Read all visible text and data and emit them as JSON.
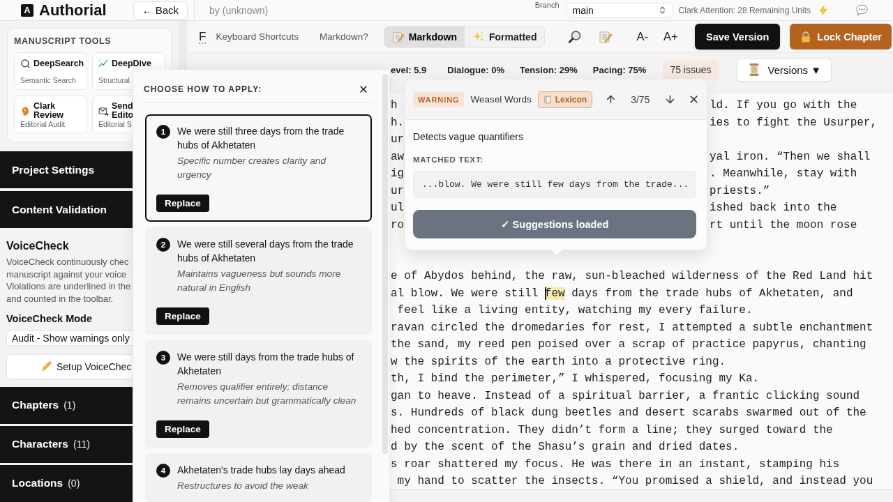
{
  "header": {
    "logo_mark": "A",
    "app_name": "Authorial",
    "back": "← Back",
    "byline": "by (unknown)",
    "branch_label": "Branch",
    "branch": "main",
    "attention": "Clark Attention: 28 Remaining Units"
  },
  "sidebar": {
    "tools_title": "MANUSCRIPT TOOLS",
    "tools": [
      {
        "kind": "search",
        "name": "DeepSearch",
        "subtitle": "Semantic Search"
      },
      {
        "kind": "chart",
        "name": "DeepDive",
        "subtitle": "Structural"
      },
      {
        "kind": "review",
        "name": "Clark Review",
        "subtitle": "Editorial Audit"
      },
      {
        "kind": "mail",
        "name": "Send\nEdito",
        "subtitle": "Editorial S"
      }
    ],
    "sections_top": [
      {
        "title": "Project Settings"
      },
      {
        "title": "Content Validation"
      }
    ],
    "voicecheck": {
      "title": "VoiceCheck",
      "description_lines": [
        "VoiceCheck continuously chec",
        "manuscript against your voice",
        "Violations are underlined in the",
        "and counted in the toolbar."
      ],
      "mode_label": "VoiceCheck Mode",
      "mode": "Audit - Show warnings only",
      "setup": "Setup VoiceChec"
    },
    "sections_bottom": [
      {
        "title": "Chapters",
        "count": "(1)"
      },
      {
        "title": "Characters",
        "count": "(11)"
      },
      {
        "title": "Locations",
        "count": "(0)"
      }
    ]
  },
  "toolbar": {
    "font": "F",
    "shortcuts": "Keyboard Shortcuts",
    "markdown_help": "Markdown?",
    "view_modes": [
      {
        "kind": "markdown",
        "label": "Markdown",
        "selected": true
      },
      {
        "kind": "formatted",
        "label": "Formatted",
        "selected": false
      }
    ],
    "smaller": "A-",
    "larger": "A+",
    "save": "Save Version",
    "lock": "Lock Chapter"
  },
  "stats": {
    "items": [
      "evel: 5.9",
      "Dialogue: 0%",
      "Tension: 29%",
      "Pacing: 75%"
    ],
    "issues": "75 issues",
    "versions": "Versions ▼"
  },
  "editor": {
    "split_lines": [
      {
        "left": "h",
        "right": "ld. If you go with the"
      },
      {
        "left": "h.",
        "right": "ies to fight the Usurper,"
      },
      {
        "left": "ur"
      },
      {
        "left": "aw",
        "right": "yal iron. “Then we shall"
      },
      {
        "left": "ig",
        "right": ". Meanwhile, stay with"
      },
      {
        "left": "ur",
        "right": "priests.”"
      },
      {
        "left": "ul",
        "right": "ished back into the"
      },
      {
        "left": "ro",
        "right": "rt until the moon rose"
      }
    ],
    "lines": [
      {
        "text": "e of Abydos behind, the raw, sun-bleached wilderness of the Red Land hit"
      },
      {
        "text": "al blow. We were still ",
        "highlight": "few",
        "after": " days from the trade hubs of Akhetaten, and"
      },
      {
        "text": " feel like a living entity, watching my every failure."
      },
      {
        "text": "ravan circled the dromedaries for rest, I attempted a subtle enchantment"
      },
      {
        "text": "the sand, my reed pen poised over a scrap of practice papyrus, chanting"
      },
      {
        "text": "w the spirits of the earth into a protective ring."
      },
      {
        "text": "th, I bind the perimeter,” I whispered, focusing my Ka."
      },
      {
        "text": "gan to heave. Instead of a spiritual barrier, a frantic clicking sound"
      },
      {
        "text": "s. Hundreds of black dung beetles and desert scarabs swarmed out of the"
      },
      {
        "text": "hed concentration. They didn’t form a line; they surged toward the"
      },
      {
        "text": "d by the scent of the Shasu’s grain and dried dates."
      },
      {
        "text": "s roar shattered my focus. He was there in an instant, stamping his"
      },
      {
        "text": " my hand to scatter the insects. “You promised a shield, and instead you"
      }
    ]
  },
  "issue": {
    "severity": "WARNING",
    "rule": "Weasel Words",
    "category": "Lexicon",
    "position": "3/75",
    "description": "Detects vague quantifiers",
    "matched_label": "MATCHED TEXT:",
    "matched_text": "...blow. We were still few days from the trade...",
    "status": "✓ Suggestions loaded"
  },
  "suggestions": {
    "title": "CHOOSE HOW TO APPLY:",
    "options": [
      {
        "number": "1",
        "text": "We were still three days from the trade hubs of Akhetaten",
        "reason": "Specific number creates clarity and urgency",
        "action": "Replace",
        "selected": true
      },
      {
        "number": "2",
        "text": "We were still several days from the trade hubs of Akhetaten",
        "reason": "Maintains vagueness but sounds more natural in English",
        "action": "Replace",
        "selected": false
      },
      {
        "number": "3",
        "text": "We were still days from the trade hubs of Akhetaten",
        "reason": "Removes qualifier entirely; distance remains uncertain but grammatically clean",
        "action": "Replace",
        "selected": false
      },
      {
        "number": "4",
        "text": "Akhetaten's trade hubs lay days ahead",
        "reason": "Restructures to avoid the weak",
        "selected": false
      }
    ]
  }
}
